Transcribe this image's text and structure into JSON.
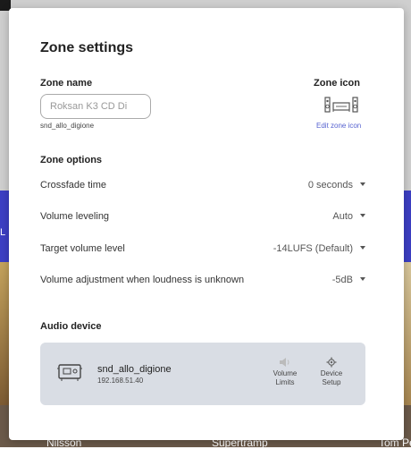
{
  "background": {
    "left_letter": "L",
    "bottom_texts": [
      "Nilsson",
      "Supertramp",
      "Tom Pe"
    ]
  },
  "modal": {
    "title": "Zone settings",
    "zone_name": {
      "label": "Zone name",
      "placeholder": "Roksan K3 CD Di",
      "device_id": "snd_allo_digione"
    },
    "zone_icon": {
      "label": "Zone icon",
      "icon": "speakers-and-amp-icon",
      "edit_link": "Edit zone icon"
    },
    "zone_options": {
      "label": "Zone options",
      "items": [
        {
          "label": "Crossfade time",
          "value": "0 seconds"
        },
        {
          "label": "Volume leveling",
          "value": "Auto"
        },
        {
          "label": "Target volume level",
          "value": "-14LUFS (Default)"
        },
        {
          "label": "Volume adjustment when loudness is unknown",
          "value": "-5dB"
        }
      ]
    },
    "audio_device": {
      "label": "Audio device",
      "name": "snd_allo_digione",
      "ip": "192.168.51.40",
      "icon": "device-board-icon",
      "actions": [
        {
          "label_line1": "Volume",
          "label_line2": "Limits",
          "icon": "speaker-icon"
        },
        {
          "label_line1": "Device",
          "label_line2": "Setup",
          "icon": "gear-icon"
        }
      ]
    }
  },
  "colors": {
    "accent": "#5763d0",
    "card": "#d9dde4",
    "bg_band": "#3c3fc4"
  }
}
